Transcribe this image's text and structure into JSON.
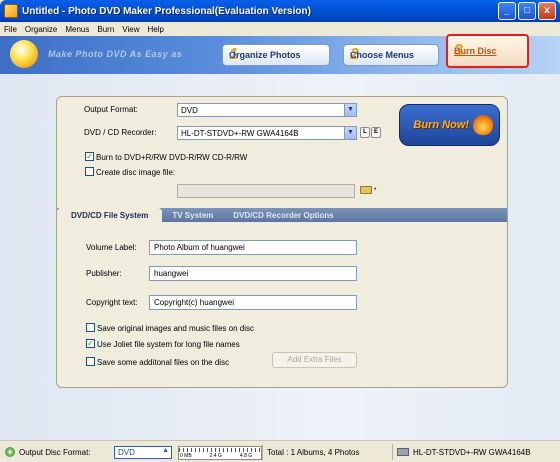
{
  "window": {
    "title": "Untitled - Photo DVD Maker Professional(Evaluation Version)",
    "minimize": "_",
    "maximize": "□",
    "close": "x"
  },
  "menu": [
    "File",
    "Organize",
    "Menus",
    "Burn",
    "View",
    "Help"
  ],
  "banner": {
    "slogan": "Make Photo DVD As Easy as",
    "steps": [
      {
        "num": "1",
        "label": "Organize Photos"
      },
      {
        "num": "2",
        "label": "Choose Menus"
      },
      {
        "num": "3",
        "label": "Burn Disc"
      }
    ]
  },
  "form": {
    "output_format_label": "Output Format:",
    "output_format_value": "DVD",
    "recorder_label": "DVD / CD Recorder:",
    "recorder_value": "HL-DT-STDVD+-RW GWA4164B",
    "btn_l": "L",
    "btn_e": "E",
    "burn_to_label": "Burn to DVD+R/RW DVD-R/RW  CD-R/RW",
    "create_image_label": "Create disc image file:",
    "image_path": "",
    "burn_now": "Burn Now!"
  },
  "tabs": [
    {
      "label": "DVD/CD File System"
    },
    {
      "label": "TV System"
    },
    {
      "label": "DVD/CD Recorder Options"
    }
  ],
  "filesystem": {
    "volume_label": "Volume Label:",
    "volume_value": "Photo Album of huangwei",
    "publisher_label": "Publisher:",
    "publisher_value": "huangwei",
    "copyright_label": "Copyright text:",
    "copyright_value": "Copyright(c) huangwei",
    "save_original": "Save original images and music files on disc",
    "use_joliet": "Use Joliet file system for long file names",
    "save_additional": "Save some additonal files on the disc",
    "add_extra_files": "Add Extra Files"
  },
  "checks": {
    "burn_to": true,
    "create_image": false,
    "save_original": false,
    "use_joliet": true,
    "save_additional": false
  },
  "status": {
    "format_label": "Output Disc Format:",
    "format_value": "DVD",
    "capacity_labels": [
      "0 MB",
      "2.4 G",
      "4.8 G"
    ],
    "capacity_used_fraction": 0.0,
    "total": "Total : 1 Albums, 4 Photos",
    "drive": "HL-DT-STDVD+-RW GWA4164B"
  }
}
